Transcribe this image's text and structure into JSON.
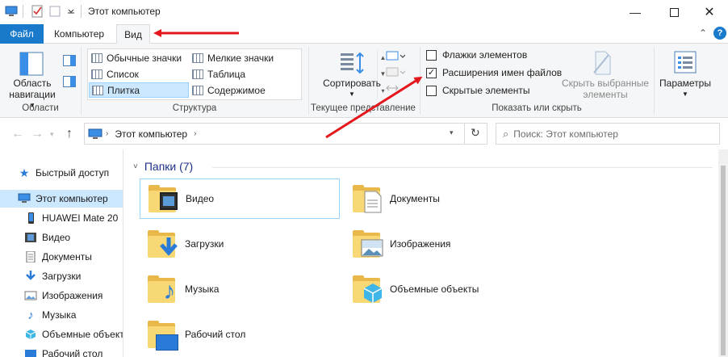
{
  "title": "Этот компьютер",
  "tabs": {
    "file": "Файл",
    "computer": "Компьютер",
    "view": "Вид"
  },
  "ribbon": {
    "panes": {
      "nav_label_line1": "Область",
      "nav_label_line2": "навигации",
      "group_label": "Области"
    },
    "layout": {
      "items": [
        "Обычные значки",
        "Мелкие значки",
        "Список",
        "Таблица",
        "Плитка",
        "Содержимое"
      ],
      "selected": "Плитка",
      "group_label": "Структура"
    },
    "current_view": {
      "sort_label": "Сортировать",
      "group_label": "Текущее представление"
    },
    "show_hide": {
      "checkboxes": [
        {
          "label": "Флажки элементов",
          "checked": false
        },
        {
          "label": "Расширения имен файлов",
          "checked": true
        },
        {
          "label": "Скрытые элементы",
          "checked": false
        }
      ],
      "hide_selected_line1": "Скрыть выбранные",
      "hide_selected_line2": "элементы",
      "group_label": "Показать или скрыть"
    },
    "options_label": "Параметры"
  },
  "address": {
    "path": "Этот компьютер",
    "search_placeholder": "Поиск: Этот компьютер"
  },
  "sidebar": {
    "items": [
      {
        "label": "Быстрый доступ",
        "icon": "star-icon"
      },
      {
        "label": "Этот компьютер",
        "icon": "computer-icon",
        "selected": true
      },
      {
        "label": "HUAWEI Mate 20",
        "icon": "phone-icon"
      },
      {
        "label": "Видео",
        "icon": "video-icon"
      },
      {
        "label": "Документы",
        "icon": "documents-icon"
      },
      {
        "label": "Загрузки",
        "icon": "downloads-icon"
      },
      {
        "label": "Изображения",
        "icon": "pictures-icon"
      },
      {
        "label": "Музыка",
        "icon": "music-icon"
      },
      {
        "label": "Объемные объекты",
        "icon": "3d-objects-icon"
      },
      {
        "label": "Рабочий стол",
        "icon": "desktop-icon"
      }
    ]
  },
  "content": {
    "section_title": "Папки (7)",
    "folders": [
      {
        "label": "Видео",
        "icon": "video-folder-icon"
      },
      {
        "label": "Документы",
        "icon": "documents-folder-icon"
      },
      {
        "label": "Загрузки",
        "icon": "downloads-folder-icon"
      },
      {
        "label": "Изображения",
        "icon": "pictures-folder-icon"
      },
      {
        "label": "Музыка",
        "icon": "music-folder-icon"
      },
      {
        "label": "Объемные объекты",
        "icon": "3d-objects-folder-icon"
      },
      {
        "label": "Рабочий стол",
        "icon": "desktop-folder-icon"
      }
    ]
  },
  "colors": {
    "accent": "#1979ca",
    "selection": "#cce8ff",
    "arrow_red": "#e3171c"
  }
}
